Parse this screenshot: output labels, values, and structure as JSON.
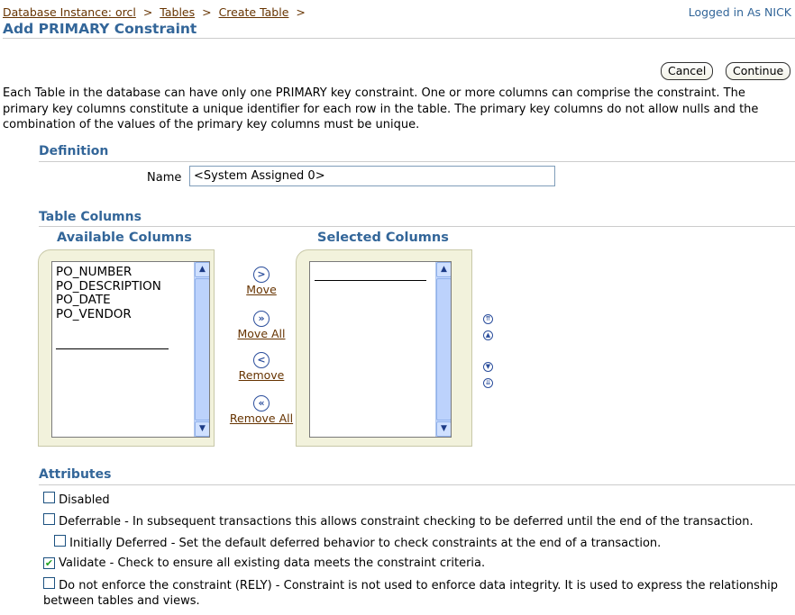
{
  "breadcrumb": {
    "items": [
      "Database Instance: orcl",
      "Tables",
      "Create Table"
    ],
    "separator": ">"
  },
  "logged_in": "Logged in As NICK",
  "page_title": "Add PRIMARY Constraint",
  "buttons": {
    "cancel": "Cancel",
    "continue": "Continue"
  },
  "intro_text": "Each Table in the database can have only one PRIMARY key constraint. One or more columns can comprise the constraint. The primary key columns constitute a unique identifier for each row in the table. The primary key columns do not allow nulls and the combination of the values of the primary key columns must be unique.",
  "definition": {
    "heading": "Definition",
    "name_label": "Name",
    "name_value": "<System Assigned 0>"
  },
  "table_columns": {
    "heading": "Table Columns",
    "available_heading": "Available Columns",
    "selected_heading": "Selected Columns",
    "available": [
      "PO_NUMBER",
      "PO_DESCRIPTION",
      "PO_DATE",
      "PO_VENDOR"
    ],
    "selected": [],
    "move_labels": {
      "move": "Move",
      "move_all": "Move All",
      "remove": "Remove",
      "remove_all": "Remove All"
    },
    "icons": {
      "move": "move-right-icon",
      "move_all": "move-all-right-icon",
      "remove": "move-left-icon",
      "remove_all": "move-all-left-icon",
      "order": [
        "move-to-top-icon",
        "move-up-icon",
        "move-down-icon",
        "move-to-bottom-icon"
      ]
    }
  },
  "attributes": {
    "heading": "Attributes",
    "disabled": {
      "label": "Disabled",
      "checked": false
    },
    "deferrable": {
      "label": "Deferrable - In subsequent transactions this allows constraint checking to be deferred until the end of the transaction.",
      "checked": false
    },
    "initially_deferred": {
      "label": "Initially Deferred - Set the default deferred behavior to check constraints at the end of a transaction.",
      "checked": false
    },
    "validate": {
      "label": "Validate - Check to ensure all existing data meets the constraint criteria.",
      "checked": true
    },
    "rely": {
      "label": "Do not enforce the constraint (RELY) - Constraint is not used to enforce data integrity. It is used to express the relationship between tables and views.",
      "checked": false
    }
  },
  "colors": {
    "heading": "#336699",
    "link": "#663300",
    "shuttle_bg": "#f2f2dc",
    "check": "#21a121"
  }
}
